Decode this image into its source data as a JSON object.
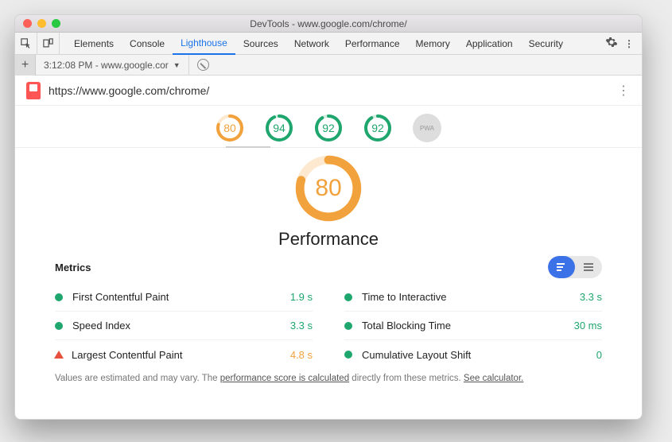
{
  "window": {
    "title": "DevTools - www.google.com/chrome/"
  },
  "tabs": {
    "items": [
      "Elements",
      "Console",
      "Lighthouse",
      "Sources",
      "Network",
      "Performance",
      "Memory",
      "Application",
      "Security"
    ],
    "active": "Lighthouse"
  },
  "subrow": {
    "report_label": "3:12:08 PM - www.google.cor"
  },
  "url": "https://www.google.com/chrome/",
  "gauges_small": [
    {
      "score": "80",
      "color": "#f2a23c"
    },
    {
      "score": "94",
      "color": "#1ea66e"
    },
    {
      "score": "92",
      "color": "#1ea66e"
    },
    {
      "score": "92",
      "color": "#1ea66e"
    },
    {
      "score": "PWA",
      "grey": true
    }
  ],
  "big_gauge": {
    "score": "80",
    "label": "Performance",
    "color": "#f2a23c"
  },
  "metrics": {
    "title": "Metrics",
    "left": [
      {
        "name": "First Contentful Paint",
        "value": "1.9 s",
        "status": "green"
      },
      {
        "name": "Speed Index",
        "value": "3.3 s",
        "status": "green"
      },
      {
        "name": "Largest Contentful Paint",
        "value": "4.8 s",
        "status": "red"
      }
    ],
    "right": [
      {
        "name": "Time to Interactive",
        "value": "3.3 s",
        "status": "green"
      },
      {
        "name": "Total Blocking Time",
        "value": "30 ms",
        "status": "green"
      },
      {
        "name": "Cumulative Layout Shift",
        "value": "0",
        "status": "green"
      }
    ]
  },
  "footnote": {
    "t1": "Values are estimated and may vary. The ",
    "l1": "performance score is calculated",
    "t2": " directly from these metrics. ",
    "l2": "See calculator."
  }
}
